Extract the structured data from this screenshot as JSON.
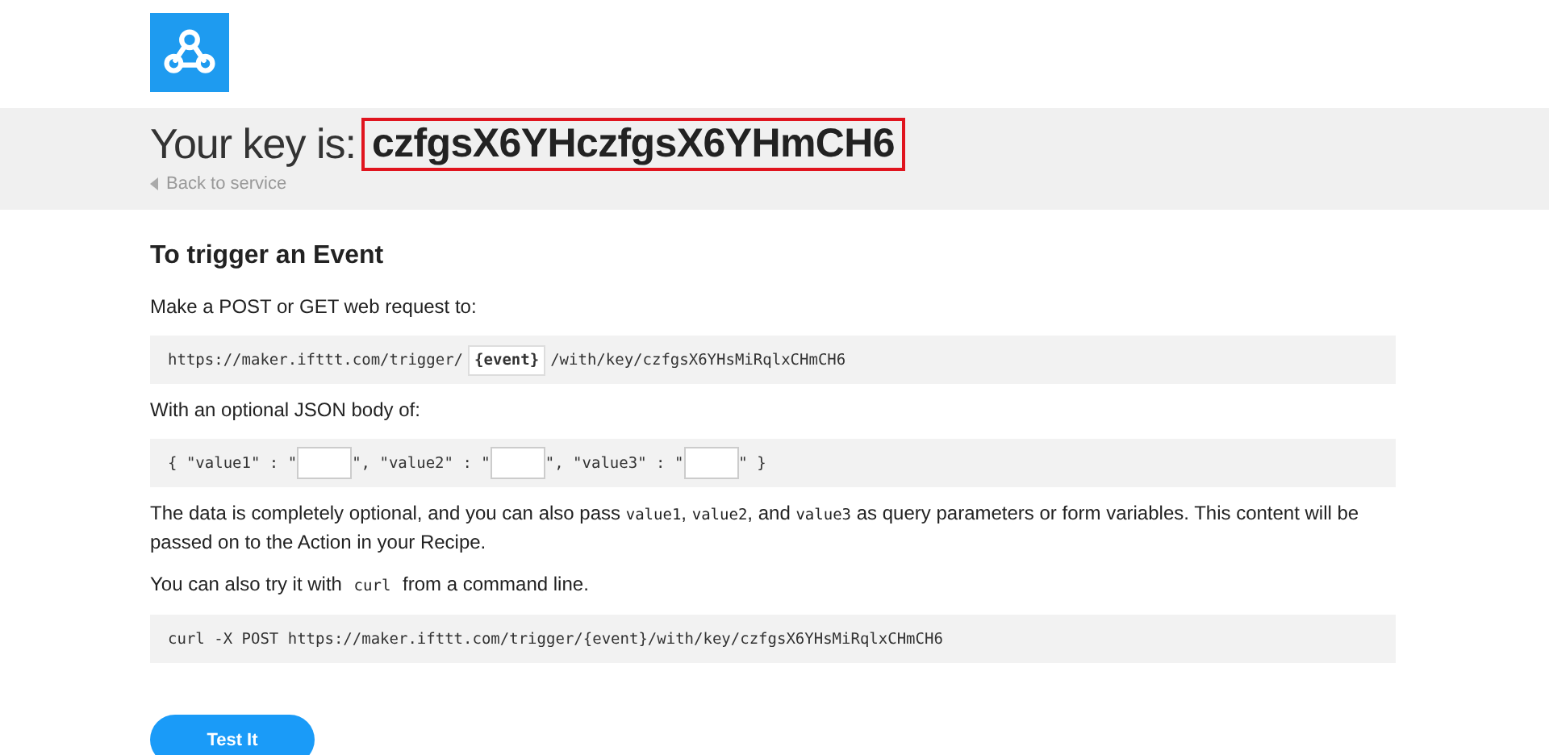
{
  "header": {
    "key_label": "Your key is:",
    "key": "czfgsX6YHczfgsX6YHmCH6",
    "key_highlighted": true,
    "back_link": "Back to service"
  },
  "section": {
    "title": "To trigger an Event",
    "request_intro": "Make a POST or GET web request to:",
    "url_prefix": "https://maker.ifttt.com/trigger/",
    "event_field": "{event}",
    "url_suffix": "/with/key/czfgsX6YHsMiRqlxCHmCH6",
    "body_intro": "With an optional JSON body of:",
    "body_parts": [
      {
        "kind": "text",
        "text": "{ \"value1\" : \""
      },
      {
        "kind": "field"
      },
      {
        "kind": "text",
        "text": "\", \"value2\" : \""
      },
      {
        "kind": "field"
      },
      {
        "kind": "text",
        "text": "\", \"value3\" : \""
      },
      {
        "kind": "field"
      },
      {
        "kind": "text",
        "text": "\" }"
      }
    ],
    "note": [
      {
        "kind": "text",
        "text": "The data is completely optional, and you can also pass "
      },
      {
        "kind": "code",
        "text": "value1"
      },
      {
        "kind": "text",
        "text": ", "
      },
      {
        "kind": "code",
        "text": "value2"
      },
      {
        "kind": "text",
        "text": ", and "
      },
      {
        "kind": "code",
        "text": "value3"
      },
      {
        "kind": "text",
        "text": " as query parameters or form variables. This content will be passed on to the Action in your Recipe."
      }
    ],
    "curl_intro": [
      {
        "kind": "text",
        "text": "You can also try it with "
      },
      {
        "kind": "code",
        "text": "curl"
      },
      {
        "kind": "text",
        "text": " from a command line."
      }
    ],
    "curl_command": "curl -X POST https://maker.ifttt.com/trigger/{event}/with/key/czfgsX6YHsMiRqlxCHmCH6",
    "button": "Test It"
  }
}
